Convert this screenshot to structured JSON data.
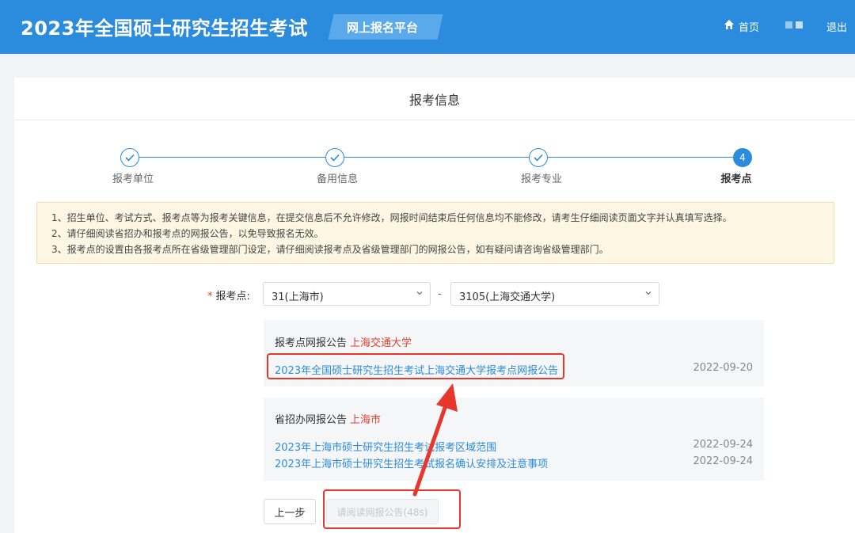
{
  "header": {
    "title": "2023年全国硕士研究生招生考试",
    "platform": "网上报名平台",
    "home_label": "首页",
    "logout_label": "退出",
    "brand_color": "#2b8cde"
  },
  "card": {
    "title": "报考信息"
  },
  "steps": [
    {
      "label": "报考单位",
      "state": "done"
    },
    {
      "label": "备用信息",
      "state": "done"
    },
    {
      "label": "报考专业",
      "state": "done"
    },
    {
      "label": "报考点",
      "state": "active",
      "number": "4"
    }
  ],
  "notice": {
    "lines": [
      "1、招生单位、考试方式、报考点等为报考关键信息，在提交信息后不允许修改，网报时间结束后任何信息均不能修改，请考生仔细阅读页面文字并认真填写选择。",
      "2、请仔细阅读省招办和报考点的网报公告，以免导致报名无效。",
      "3、报考点的设置由各报考点所在省级管理部门设定，请仔细阅读报考点及省级管理部门的网报公告，如有疑问请咨询省级管理部门。"
    ]
  },
  "form": {
    "required_mark": "*",
    "label": "报考点:",
    "province_value": "31(上海市)",
    "separator": "-",
    "site_value": "3105(上海交通大学)"
  },
  "site_notices": {
    "title": "报考点网报公告",
    "org": "上海交通大学",
    "items": [
      {
        "text": "2023年全国硕士研究生招生考试上海交通大学报考点网报公告",
        "date": "2022-09-20"
      }
    ]
  },
  "province_notices": {
    "title": "省招办网报公告",
    "org": "上海市",
    "items": [
      {
        "text": "2023年上海市硕士研究生招生考试报考区域范围",
        "date": "2022-09-24"
      },
      {
        "text": "2023年上海市硕士研究生招生考试报名确认安排及注意事项",
        "date": "2022-09-24"
      }
    ]
  },
  "buttons": {
    "prev": "上一步",
    "read": "请阅读网报公告(48s)"
  },
  "annotation_color": "#e5372c"
}
